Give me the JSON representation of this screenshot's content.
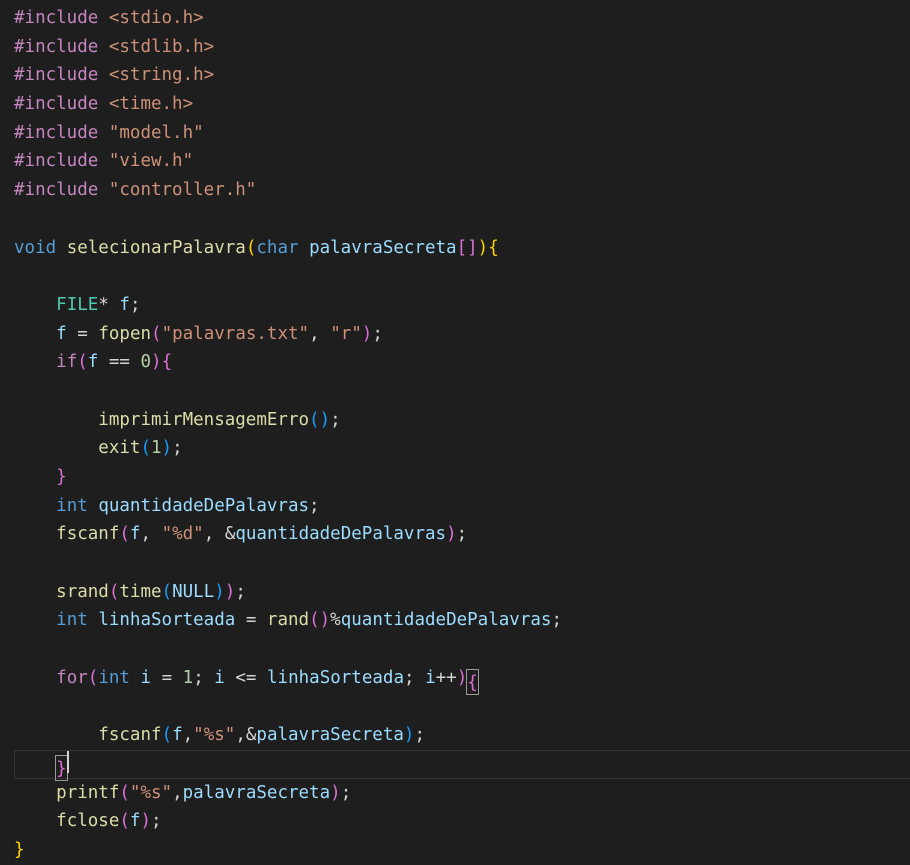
{
  "editor": {
    "language": "c",
    "background_color": "#1e1e1e",
    "foreground_color": "#d4d4d4",
    "current_line_number": 27,
    "caret_visible": true,
    "bracket_match_highlight": true,
    "colors": {
      "preprocessor": "#c586c0",
      "control_keyword": "#c586c0",
      "type_keyword": "#569cd6",
      "class_type": "#4ec9b0",
      "function": "#dcdcaa",
      "variable": "#9cdcfe",
      "string": "#ce9178",
      "number": "#b5cea8",
      "operator": "#d4d4d4",
      "bracket_level_1": "#ffd700",
      "bracket_level_2": "#da70d6",
      "bracket_level_3": "#179fff",
      "current_line_border": "#343434",
      "bracket_match_border": "#9a9a9a"
    }
  },
  "code": {
    "lines": [
      "#include <stdio.h>",
      "#include <stdlib.h>",
      "#include <string.h>",
      "#include <time.h>",
      "#include \"model.h\"",
      "#include \"view.h\"",
      "#include \"controller.h\"",
      "",
      "void selecionarPalavra(char palavraSecreta[]){",
      "",
      "    FILE* f;",
      "    f = fopen(\"palavras.txt\", \"r\");",
      "    if(f == 0){",
      "",
      "        imprimirMensagemErro();",
      "        exit(1);",
      "    }",
      "    int quantidadeDePalavras;",
      "    fscanf(f, \"%d\", &quantidadeDePalavras);",
      "",
      "    srand(time(NULL));",
      "    int linhaSorteada = rand()%quantidadeDePalavras;",
      "",
      "    for(int i = 1; i <= linhaSorteada; i++){",
      "",
      "        fscanf(f,\"%s\",&palavraSecreta);",
      "    }",
      "    printf(\"%s\",palavraSecreta);",
      "    fclose(f);",
      "}"
    ],
    "tokens": {
      "include_directive": "#include",
      "header_stdio": "<stdio.h>",
      "header_stdlib": "<stdlib.h>",
      "header_string": "<string.h>",
      "header_time": "<time.h>",
      "header_model": "\"model.h\"",
      "header_view": "\"view.h\"",
      "header_controller": "\"controller.h\"",
      "kw_void": "void",
      "kw_char": "char",
      "kw_int": "int",
      "kw_if": "if",
      "kw_for": "for",
      "type_FILE": "FILE",
      "fn_selecionarPalavra": "selecionarPalavra",
      "fn_fopen": "fopen",
      "fn_imprimirMensagemErro": "imprimirMensagemErro",
      "fn_exit": "exit",
      "fn_fscanf": "fscanf",
      "fn_srand": "srand",
      "fn_time": "time",
      "fn_rand": "rand",
      "fn_printf": "printf",
      "fn_fclose": "fclose",
      "var_palavraSecreta": "palavraSecreta",
      "var_f": "f",
      "var_quantidadeDePalavras": "quantidadeDePalavras",
      "var_linhaSorteada": "linhaSorteada",
      "var_i": "i",
      "var_NULL": "NULL",
      "str_palavras_txt": "\"palavras.txt\"",
      "str_r": "\"r\"",
      "str_pct_d": "\"%d\"",
      "str_pct_s": "\"%s\"",
      "num_zero": "0",
      "num_one": "1",
      "op_star": "*",
      "op_semicolon": ";",
      "op_assign": "=",
      "op_equals": "==",
      "op_lte": "<=",
      "op_increment": "++",
      "op_ampersand": "&",
      "op_modulo": "%",
      "op_comma": ",",
      "op_square_brackets": "[]"
    }
  }
}
